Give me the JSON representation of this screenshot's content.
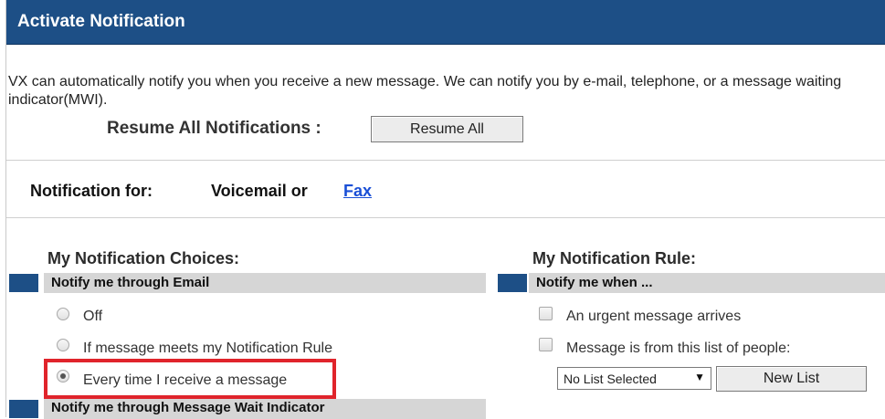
{
  "header": {
    "title": "Activate Notification"
  },
  "intro": {
    "text": "VX can automatically notify you when you receive a new message. We can notify you by e-mail, telephone, or a message waiting indicator(MWI)."
  },
  "resume": {
    "label": "Resume All Notifications :",
    "button_label": "Resume All"
  },
  "notification_for": {
    "label": "Notification for:",
    "type": "Voicemail or",
    "link": "Fax"
  },
  "choices": {
    "title": "My Notification Choices:",
    "email_section": "Notify me through Email",
    "options": [
      {
        "label": "Off",
        "selected": false
      },
      {
        "label": "If message meets my Notification Rule",
        "selected": false
      },
      {
        "label": "Every time I receive a message",
        "selected": true
      }
    ],
    "mwi_section": "Notify me through Message Wait Indicator"
  },
  "rule": {
    "title": "My Notification Rule:",
    "section": "Notify me when ...",
    "options": [
      {
        "label": "An urgent message arrives",
        "checked": false
      },
      {
        "label": "Message is from this list of people:",
        "checked": false
      }
    ],
    "list_select": "No List Selected",
    "new_list_button": "New List"
  },
  "colors": {
    "header_bg": "#1d4f86",
    "section_bar": "#d6d6d6",
    "highlight": "#e0242b",
    "link": "#1a4fd6"
  }
}
